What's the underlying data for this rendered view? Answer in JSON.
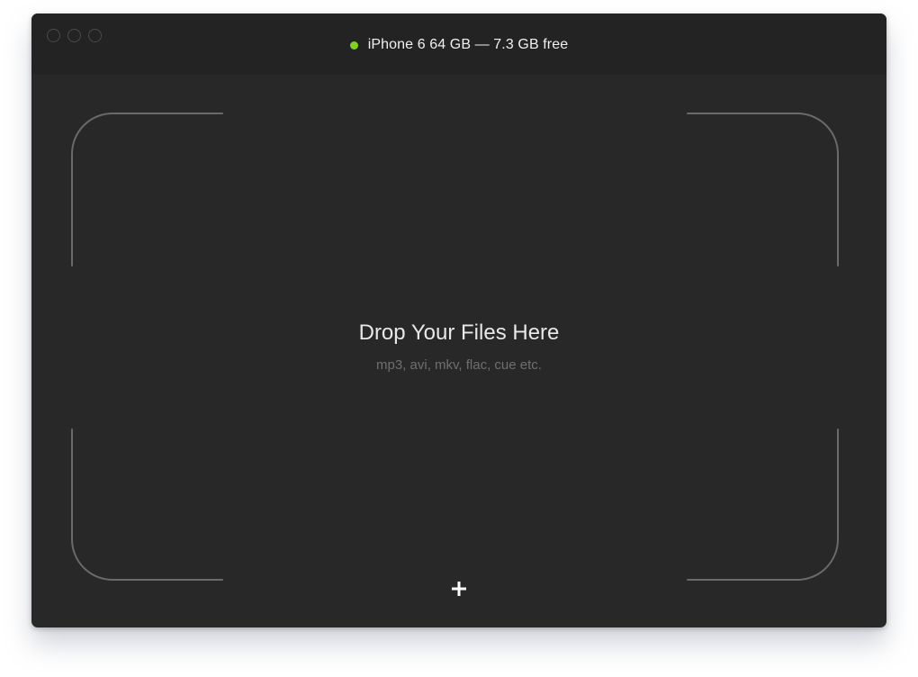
{
  "window": {
    "device": {
      "status_color": "#7ed321",
      "label": "iPhone 6 64 GB — 7.3 GB free"
    }
  },
  "drop_zone": {
    "title": "Drop Your Files Here",
    "subtitle": "mp3, avi, mkv, flac, cue etc."
  },
  "add_button": {
    "icon": "plus-icon"
  }
}
